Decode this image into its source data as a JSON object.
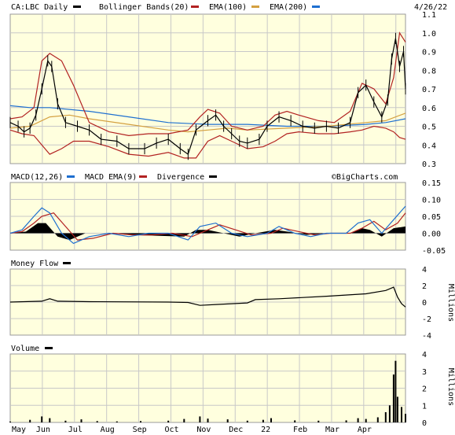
{
  "colors": {
    "plot_bg": "#ffffde",
    "grid": "#c8c8c8",
    "price": "#000000",
    "bollinger": "#b22222",
    "ema100": "#d4a040",
    "ema200": "#1e6fd0",
    "macd": "#1e6fd0",
    "macd_ema": "#b22222",
    "divergence": "#000000",
    "money_flow": "#000000",
    "volume": "#000000"
  },
  "header": {
    "symbol": "CA:LBC Daily",
    "bollinger": "Bollinger Bands(20)",
    "ema100": "EMA(100)",
    "ema200": "EMA(200)",
    "date": "4/26/22"
  },
  "macd_panel": {
    "macd": "MACD(12,26)",
    "macd_ema": "MACD EMA(9)",
    "divergence": "Divergence",
    "watermark": "©BigCharts.com"
  },
  "money_flow_panel": {
    "title": "Money Flow",
    "unit": "Millions"
  },
  "volume_panel": {
    "title": "Volume",
    "unit": "Millions"
  },
  "chart_data": [
    {
      "type": "line",
      "name": "price",
      "x_labels": [
        "May",
        "Jun",
        "Jul",
        "Aug",
        "Sep",
        "Oct",
        "Nov",
        "Dec",
        "22",
        "Feb",
        "Mar",
        "Apr"
      ],
      "y_ticks": [
        "1.1",
        "1.0",
        "0.9",
        "0.8",
        "0.7",
        "0.6",
        "0.5",
        "0.4",
        "0.3"
      ],
      "ylim": [
        0.3,
        1.1
      ],
      "price": [
        [
          0,
          0.52
        ],
        [
          0.02,
          0.5
        ],
        [
          0.035,
          0.47
        ],
        [
          0.05,
          0.49
        ],
        [
          0.065,
          0.56
        ],
        [
          0.08,
          0.7
        ],
        [
          0.095,
          0.85
        ],
        [
          0.105,
          0.82
        ],
        [
          0.12,
          0.62
        ],
        [
          0.14,
          0.52
        ],
        [
          0.17,
          0.5
        ],
        [
          0.2,
          0.48
        ],
        [
          0.23,
          0.43
        ],
        [
          0.27,
          0.42
        ],
        [
          0.3,
          0.38
        ],
        [
          0.34,
          0.38
        ],
        [
          0.37,
          0.41
        ],
        [
          0.4,
          0.43
        ],
        [
          0.43,
          0.38
        ],
        [
          0.45,
          0.35
        ],
        [
          0.47,
          0.48
        ],
        [
          0.5,
          0.53
        ],
        [
          0.52,
          0.56
        ],
        [
          0.54,
          0.5
        ],
        [
          0.56,
          0.46
        ],
        [
          0.58,
          0.42
        ],
        [
          0.6,
          0.41
        ],
        [
          0.63,
          0.43
        ],
        [
          0.65,
          0.5
        ],
        [
          0.68,
          0.55
        ],
        [
          0.71,
          0.53
        ],
        [
          0.74,
          0.5
        ],
        [
          0.77,
          0.49
        ],
        [
          0.8,
          0.5
        ],
        [
          0.83,
          0.49
        ],
        [
          0.86,
          0.52
        ],
        [
          0.88,
          0.68
        ],
        [
          0.9,
          0.72
        ],
        [
          0.92,
          0.63
        ],
        [
          0.94,
          0.55
        ],
        [
          0.955,
          0.64
        ],
        [
          0.965,
          0.86
        ],
        [
          0.975,
          0.97
        ],
        [
          0.985,
          0.82
        ],
        [
          0.995,
          0.9
        ],
        [
          1.0,
          0.7
        ]
      ],
      "bollinger_upper": [
        [
          0,
          0.54
        ],
        [
          0.03,
          0.55
        ],
        [
          0.06,
          0.6
        ],
        [
          0.08,
          0.85
        ],
        [
          0.1,
          0.89
        ],
        [
          0.13,
          0.85
        ],
        [
          0.16,
          0.72
        ],
        [
          0.2,
          0.52
        ],
        [
          0.25,
          0.47
        ],
        [
          0.3,
          0.45
        ],
        [
          0.35,
          0.46
        ],
        [
          0.4,
          0.46
        ],
        [
          0.45,
          0.48
        ],
        [
          0.48,
          0.55
        ],
        [
          0.5,
          0.59
        ],
        [
          0.53,
          0.57
        ],
        [
          0.56,
          0.5
        ],
        [
          0.6,
          0.48
        ],
        [
          0.64,
          0.5
        ],
        [
          0.67,
          0.56
        ],
        [
          0.7,
          0.58
        ],
        [
          0.73,
          0.56
        ],
        [
          0.78,
          0.53
        ],
        [
          0.82,
          0.52
        ],
        [
          0.86,
          0.58
        ],
        [
          0.89,
          0.73
        ],
        [
          0.92,
          0.7
        ],
        [
          0.95,
          0.62
        ],
        [
          0.97,
          0.76
        ],
        [
          0.985,
          1.0
        ],
        [
          1.0,
          0.95
        ]
      ],
      "bollinger_lower": [
        [
          0,
          0.48
        ],
        [
          0.03,
          0.46
        ],
        [
          0.06,
          0.45
        ],
        [
          0.08,
          0.4
        ],
        [
          0.1,
          0.35
        ],
        [
          0.13,
          0.38
        ],
        [
          0.16,
          0.42
        ],
        [
          0.2,
          0.42
        ],
        [
          0.25,
          0.39
        ],
        [
          0.3,
          0.35
        ],
        [
          0.35,
          0.34
        ],
        [
          0.4,
          0.36
        ],
        [
          0.44,
          0.33
        ],
        [
          0.47,
          0.33
        ],
        [
          0.5,
          0.42
        ],
        [
          0.53,
          0.45
        ],
        [
          0.56,
          0.42
        ],
        [
          0.6,
          0.38
        ],
        [
          0.64,
          0.39
        ],
        [
          0.67,
          0.42
        ],
        [
          0.7,
          0.46
        ],
        [
          0.73,
          0.47
        ],
        [
          0.78,
          0.46
        ],
        [
          0.82,
          0.46
        ],
        [
          0.86,
          0.47
        ],
        [
          0.89,
          0.48
        ],
        [
          0.92,
          0.5
        ],
        [
          0.95,
          0.49
        ],
        [
          0.97,
          0.47
        ],
        [
          0.985,
          0.44
        ],
        [
          1.0,
          0.43
        ]
      ],
      "ema100": [
        [
          0,
          0.49
        ],
        [
          0.05,
          0.5
        ],
        [
          0.1,
          0.55
        ],
        [
          0.15,
          0.56
        ],
        [
          0.2,
          0.54
        ],
        [
          0.3,
          0.51
        ],
        [
          0.4,
          0.48
        ],
        [
          0.45,
          0.47
        ],
        [
          0.5,
          0.48
        ],
        [
          0.55,
          0.49
        ],
        [
          0.6,
          0.48
        ],
        [
          0.7,
          0.49
        ],
        [
          0.8,
          0.5
        ],
        [
          0.9,
          0.52
        ],
        [
          0.95,
          0.53
        ],
        [
          1.0,
          0.57
        ]
      ],
      "ema200": [
        [
          0,
          0.61
        ],
        [
          0.05,
          0.6
        ],
        [
          0.1,
          0.6
        ],
        [
          0.2,
          0.58
        ],
        [
          0.3,
          0.55
        ],
        [
          0.4,
          0.52
        ],
        [
          0.5,
          0.51
        ],
        [
          0.6,
          0.51
        ],
        [
          0.7,
          0.5
        ],
        [
          0.8,
          0.5
        ],
        [
          0.9,
          0.51
        ],
        [
          0.95,
          0.52
        ],
        [
          1.0,
          0.54
        ]
      ]
    },
    {
      "type": "line",
      "name": "macd",
      "y_ticks": [
        "0.15",
        "0.10",
        "0.05",
        "0.00",
        "-0.05"
      ],
      "ylim": [
        -0.05,
        0.15
      ],
      "macd": [
        [
          0,
          0
        ],
        [
          0.03,
          0.01
        ],
        [
          0.06,
          0.05
        ],
        [
          0.08,
          0.075
        ],
        [
          0.1,
          0.06
        ],
        [
          0.13,
          0.0
        ],
        [
          0.16,
          -0.03
        ],
        [
          0.2,
          -0.01
        ],
        [
          0.25,
          0.0
        ],
        [
          0.3,
          -0.01
        ],
        [
          0.35,
          0.0
        ],
        [
          0.4,
          0.0
        ],
        [
          0.45,
          -0.02
        ],
        [
          0.48,
          0.02
        ],
        [
          0.52,
          0.03
        ],
        [
          0.56,
          0.0
        ],
        [
          0.6,
          -0.01
        ],
        [
          0.65,
          0.0
        ],
        [
          0.68,
          0.02
        ],
        [
          0.72,
          0.0
        ],
        [
          0.76,
          -0.01
        ],
        [
          0.8,
          0.0
        ],
        [
          0.85,
          0.0
        ],
        [
          0.88,
          0.03
        ],
        [
          0.91,
          0.04
        ],
        [
          0.94,
          0.0
        ],
        [
          0.97,
          0.04
        ],
        [
          1.0,
          0.08
        ]
      ],
      "macd_ema": [
        [
          0,
          0
        ],
        [
          0.03,
          0.005
        ],
        [
          0.06,
          0.03
        ],
        [
          0.08,
          0.05
        ],
        [
          0.11,
          0.06
        ],
        [
          0.14,
          0.02
        ],
        [
          0.17,
          -0.02
        ],
        [
          0.21,
          -0.015
        ],
        [
          0.26,
          0.0
        ],
        [
          0.31,
          -0.005
        ],
        [
          0.36,
          -0.005
        ],
        [
          0.41,
          0.0
        ],
        [
          0.46,
          -0.01
        ],
        [
          0.5,
          0.01
        ],
        [
          0.53,
          0.025
        ],
        [
          0.57,
          0.01
        ],
        [
          0.61,
          -0.005
        ],
        [
          0.66,
          0.0
        ],
        [
          0.69,
          0.015
        ],
        [
          0.73,
          0.005
        ],
        [
          0.77,
          -0.005
        ],
        [
          0.81,
          0.0
        ],
        [
          0.86,
          0.0
        ],
        [
          0.89,
          0.015
        ],
        [
          0.92,
          0.035
        ],
        [
          0.95,
          0.01
        ],
        [
          0.98,
          0.03
        ],
        [
          1.0,
          0.06
        ]
      ],
      "divergence": [
        [
          0,
          0
        ],
        [
          0.04,
          0.005
        ],
        [
          0.07,
          0.03
        ],
        [
          0.09,
          0.03
        ],
        [
          0.12,
          -0.01
        ],
        [
          0.15,
          -0.02
        ],
        [
          0.19,
          0.0
        ],
        [
          0.25,
          0.0
        ],
        [
          0.3,
          -0.005
        ],
        [
          0.44,
          -0.01
        ],
        [
          0.47,
          0.01
        ],
        [
          0.5,
          0.01
        ],
        [
          0.54,
          0.0
        ],
        [
          0.58,
          -0.01
        ],
        [
          0.62,
          0.0
        ],
        [
          0.67,
          0.01
        ],
        [
          0.7,
          0.005
        ],
        [
          0.75,
          -0.005
        ],
        [
          0.8,
          0.0
        ],
        [
          0.86,
          0.0
        ],
        [
          0.89,
          0.015
        ],
        [
          0.91,
          0.01
        ],
        [
          0.94,
          -0.01
        ],
        [
          0.97,
          0.015
        ],
        [
          1.0,
          0.02
        ]
      ]
    },
    {
      "type": "line",
      "name": "money_flow",
      "y_ticks": [
        "4",
        "2",
        "0",
        "-2",
        "-4"
      ],
      "ylim": [
        -4,
        4
      ],
      "values": [
        [
          0,
          0
        ],
        [
          0.08,
          0.1
        ],
        [
          0.1,
          0.4
        ],
        [
          0.12,
          0.1
        ],
        [
          0.2,
          0.05
        ],
        [
          0.4,
          0.0
        ],
        [
          0.45,
          -0.05
        ],
        [
          0.48,
          -0.4
        ],
        [
          0.52,
          -0.3
        ],
        [
          0.6,
          -0.1
        ],
        [
          0.62,
          0.3
        ],
        [
          0.68,
          0.4
        ],
        [
          0.8,
          0.7
        ],
        [
          0.9,
          1.0
        ],
        [
          0.95,
          1.4
        ],
        [
          0.97,
          1.8
        ],
        [
          0.98,
          0.6
        ],
        [
          0.99,
          -0.2
        ],
        [
          1.0,
          -0.6
        ]
      ]
    },
    {
      "type": "bar",
      "name": "volume",
      "y_ticks": [
        "4",
        "3",
        "2",
        "1",
        "0"
      ],
      "ylim": [
        0,
        4
      ],
      "values": [
        [
          0,
          0.05
        ],
        [
          0.05,
          0.15
        ],
        [
          0.08,
          0.35
        ],
        [
          0.1,
          0.25
        ],
        [
          0.14,
          0.1
        ],
        [
          0.18,
          0.18
        ],
        [
          0.22,
          0.08
        ],
        [
          0.27,
          0.06
        ],
        [
          0.33,
          0.08
        ],
        [
          0.4,
          0.1
        ],
        [
          0.44,
          0.2
        ],
        [
          0.48,
          0.35
        ],
        [
          0.5,
          0.22
        ],
        [
          0.55,
          0.18
        ],
        [
          0.6,
          0.1
        ],
        [
          0.64,
          0.15
        ],
        [
          0.66,
          0.25
        ],
        [
          0.72,
          0.12
        ],
        [
          0.78,
          0.1
        ],
        [
          0.85,
          0.12
        ],
        [
          0.88,
          0.25
        ],
        [
          0.9,
          0.2
        ],
        [
          0.93,
          0.3
        ],
        [
          0.95,
          0.6
        ],
        [
          0.96,
          1.0
        ],
        [
          0.97,
          2.8
        ],
        [
          0.975,
          3.6
        ],
        [
          0.98,
          1.5
        ],
        [
          0.99,
          0.9
        ],
        [
          1.0,
          0.5
        ]
      ]
    }
  ]
}
